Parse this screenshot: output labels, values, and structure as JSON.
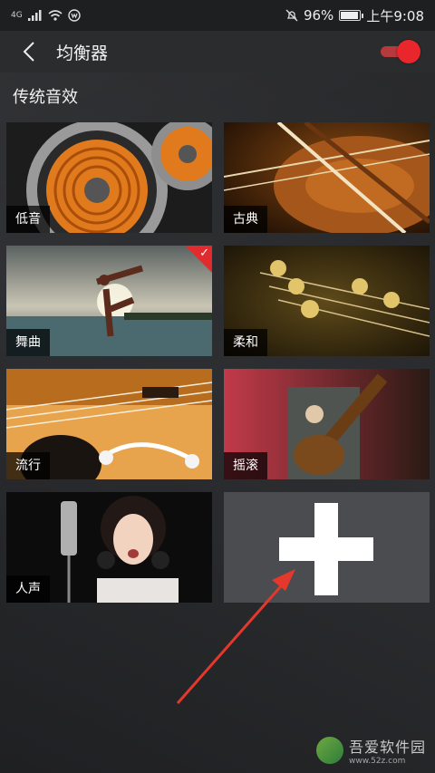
{
  "status_bar": {
    "network": "4G",
    "battery_percent": "96%",
    "battery_level": 0.96,
    "time": "上午9:08"
  },
  "title_bar": {
    "title": "均衡器",
    "toggle_on": true,
    "accent_color": "#e8262b"
  },
  "section_title": "传统音效",
  "presets": [
    {
      "label": "低音",
      "selected": false
    },
    {
      "label": "古典",
      "selected": false
    },
    {
      "label": "舞曲",
      "selected": true
    },
    {
      "label": "柔和",
      "selected": false
    },
    {
      "label": "流行",
      "selected": false
    },
    {
      "label": "摇滚",
      "selected": false
    },
    {
      "label": "人声",
      "selected": false
    }
  ],
  "add_button_icon": "plus-icon",
  "watermark": {
    "name": "吾爱软件园",
    "url": "www.52z.com"
  }
}
